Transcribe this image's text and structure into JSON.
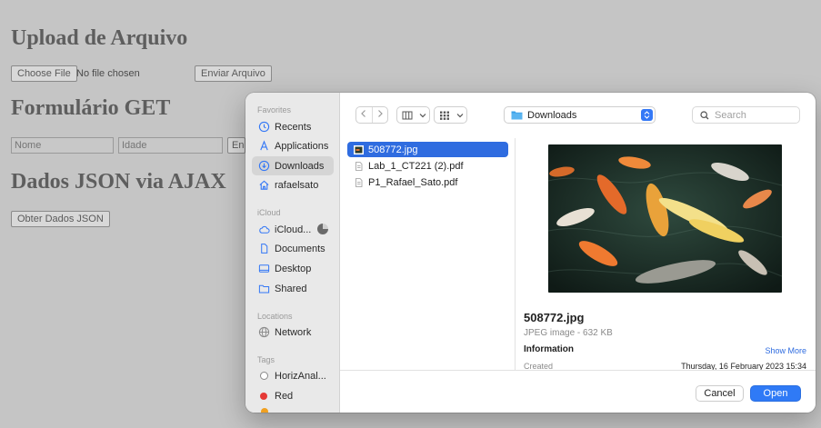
{
  "page": {
    "heading_upload": "Upload de Arquivo",
    "choose_file": "Choose File",
    "no_file": "No file chosen",
    "send_file": "Enviar Arquivo",
    "heading_get": "Formulário GET",
    "name_placeholder": "Nome",
    "age_placeholder": "Idade",
    "submit_partial": "En",
    "heading_json": "Dados JSON via AJAX",
    "get_json": "Obter Dados JSON"
  },
  "dialog": {
    "sidebar": {
      "favorites_label": "Favorites",
      "favorites": [
        {
          "label": "Recents",
          "icon": "clock-icon"
        },
        {
          "label": "Applications",
          "icon": "applications-icon"
        },
        {
          "label": "Downloads",
          "icon": "download-icon"
        },
        {
          "label": "rafaelsato",
          "icon": "home-icon"
        }
      ],
      "icloud_label": "iCloud",
      "icloud": [
        {
          "label": "iCloud...",
          "icon": "cloud-icon"
        },
        {
          "label": "Documents",
          "icon": "document-icon"
        },
        {
          "label": "Desktop",
          "icon": "desktop-icon"
        },
        {
          "label": "Shared",
          "icon": "shared-folder-icon"
        }
      ],
      "locations_label": "Locations",
      "locations": [
        {
          "label": "Network",
          "icon": "network-icon"
        }
      ],
      "tags_label": "Tags",
      "tags": [
        {
          "label": "HorizAnal...",
          "color": "#ffffff"
        },
        {
          "label": "Red",
          "color": "#e53935"
        }
      ]
    },
    "toolbar": {
      "location": "Downloads",
      "search_placeholder": "Search"
    },
    "files": [
      {
        "name": "508772.jpg",
        "selected": true
      },
      {
        "name": "Lab_1_CT221 (2).pdf",
        "selected": false
      },
      {
        "name": "P1_Rafael_Sato.pdf",
        "selected": false
      }
    ],
    "preview": {
      "name": "508772.jpg",
      "kind": "JPEG image - 632 KB",
      "info_label": "Information",
      "show_more": "Show More",
      "created_label": "Created",
      "created_value": "Thursday, 16 February 2023 15:34"
    },
    "buttons": {
      "cancel": "Cancel",
      "open": "Open"
    },
    "colors": {
      "accent": "#2f6ce0",
      "tag_red": "#e53935"
    }
  }
}
